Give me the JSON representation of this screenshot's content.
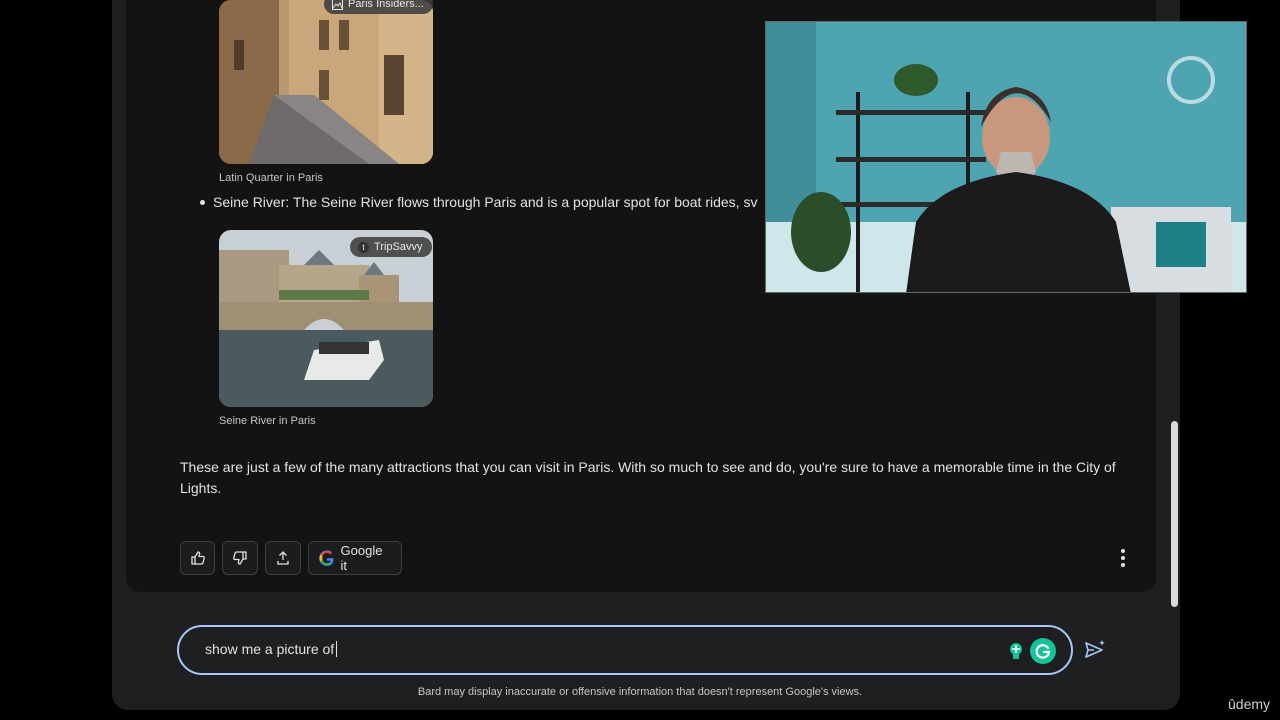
{
  "images": {
    "latin_quarter": {
      "source": "Paris Insiders...",
      "caption": "Latin Quarter in Paris"
    },
    "seine": {
      "source": "TripSavvy",
      "caption": "Seine River in Paris"
    }
  },
  "bullet": "Seine River: The Seine River flows through Paris and is a popular spot for boat rides, sv",
  "paragraph": "These are just a few of the many attractions that you can visit in Paris. With so much to see and do, you're sure to have a memorable time in the City of Lights.",
  "actions": {
    "google_it": "Google it"
  },
  "input": {
    "value": "show me a picture of"
  },
  "disclaimer": "Bard may display inaccurate or offensive information that doesn't represent Google's views.",
  "watermark": "ûdemy",
  "colors": {
    "accent": "#a8c7fa",
    "grammarly": "#15c39a",
    "background": "#131314"
  },
  "icons": [
    "thumbs-up-icon",
    "thumbs-down-icon",
    "share-icon",
    "google-g-icon",
    "more-vert-icon",
    "bulb-icon",
    "grammarly-icon",
    "send-icon"
  ]
}
